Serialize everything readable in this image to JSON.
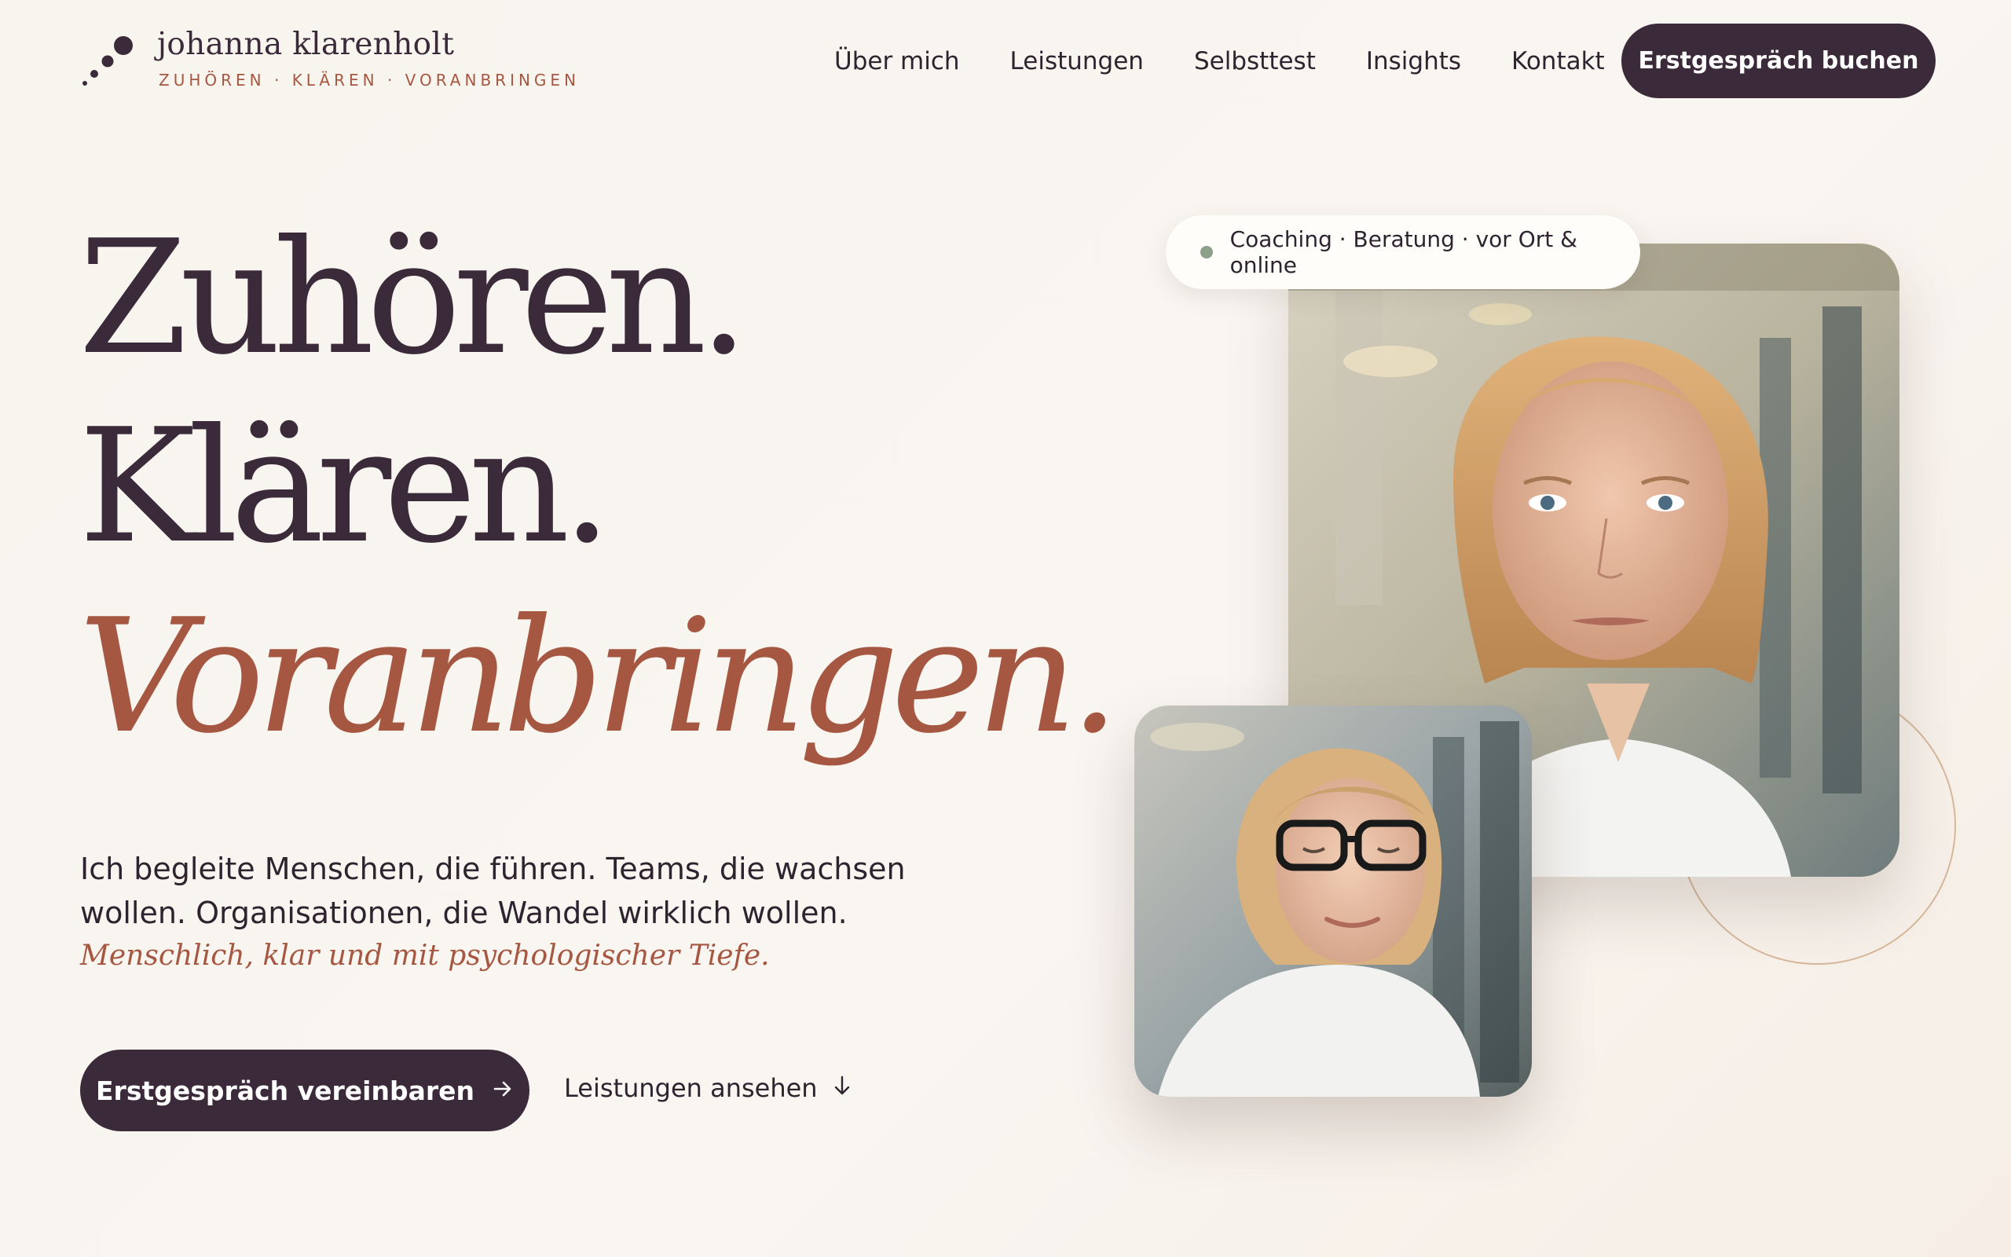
{
  "brand": {
    "name": "johanna klarenholt",
    "tagline": "ZUHÖREN · KLÄREN · VORANBRINGEN"
  },
  "nav": {
    "items": [
      "Über mich",
      "Leistungen",
      "Selbsttest",
      "Insights",
      "Kontakt"
    ],
    "cta": "Erstgespräch buchen"
  },
  "hero": {
    "line1": "Zuhören.",
    "line2": "Klären.",
    "line3": "Voranbringen.",
    "lead": "Ich begleite Menschen, die führen. Teams, die wachsen wollen. Organisationen, die Wandel wirklich wollen.",
    "accent": "Menschlich, klar und mit psychologischer Tiefe.",
    "primary_button": "Erstgespräch vereinbaren",
    "secondary_link": "Leistungen ansehen",
    "badge": "Coaching · Beratung · vor Ort & online"
  },
  "icons": {
    "primary_arrow": "arrow-right-icon",
    "secondary_arrow": "arrow-down-icon",
    "logo": "dots-logo-icon"
  },
  "colors": {
    "plum": "#3a2a3a",
    "terracotta": "#a65741",
    "background": "#f8f4ee",
    "sage": "#8da08a"
  }
}
